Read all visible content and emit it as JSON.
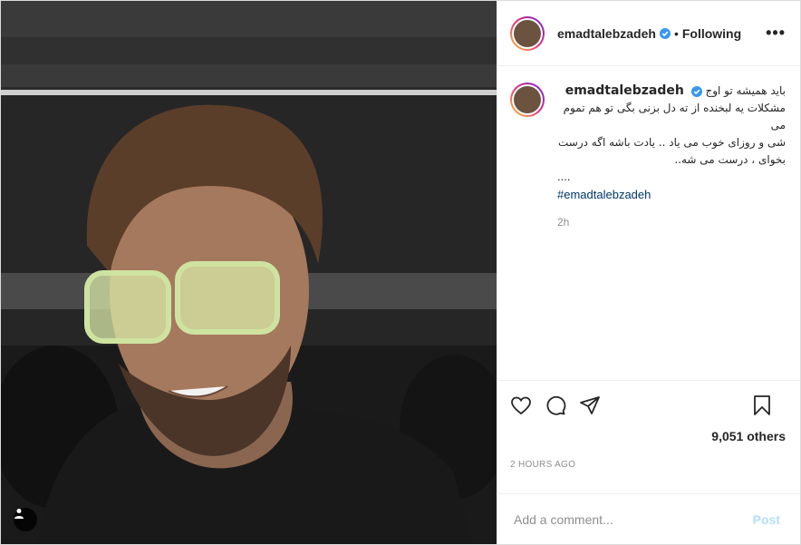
{
  "post": {
    "username": "emadtalebzadeh",
    "follow_status": "Following",
    "more_icon": "•••",
    "verified": true
  },
  "caption": {
    "username": "emadtalebzadeh",
    "lines": [
      "باید همیشه تو اوج",
      "مشکلات یه لبخنده از ته دل بزنی بگی تو هم تموم می",
      "شی و روزای خوب می یاد .. یادت باشه اگه درست",
      "بخوای ، درست می شه..",
      "...."
    ],
    "hashtag": "#emadtalebzadeh",
    "age": "2h"
  },
  "actions": {
    "icons": [
      "heart-icon",
      "comment-icon",
      "share-icon",
      "bookmark-icon"
    ],
    "likes": "9,051 others",
    "posted_time": "2 HOURS AGO"
  },
  "comment_box": {
    "placeholder": "Add a comment...",
    "post_label": "Post"
  },
  "colors": {
    "verified": "#3897f0",
    "hashtag": "#00376b",
    "post_disabled": "#b2dffc"
  }
}
